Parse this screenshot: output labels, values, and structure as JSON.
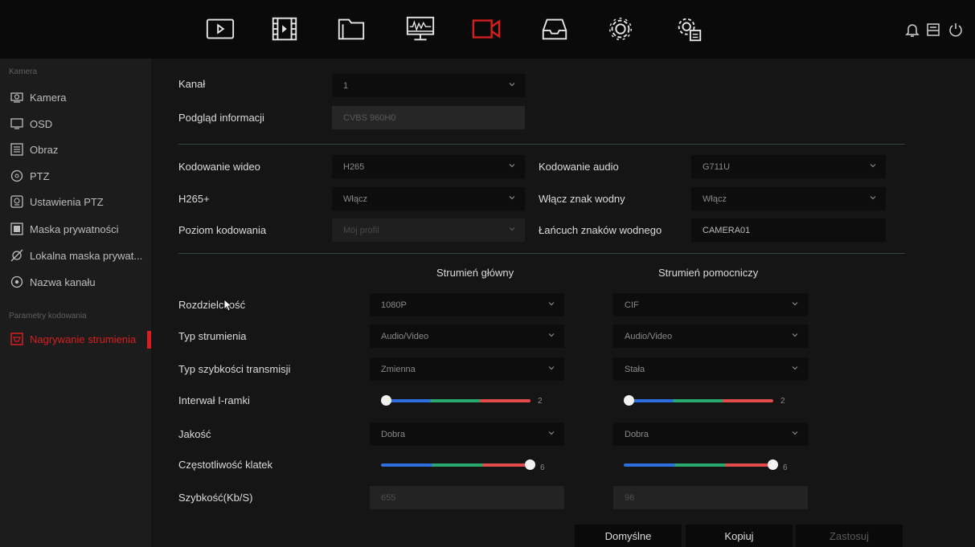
{
  "colors": {
    "accent": "#d81f1f",
    "slider_blue": "#2f6ee0",
    "slider_green": "#28a86c",
    "slider_red": "#e34a4a"
  },
  "topbar": {
    "icons": [
      "playback-icon",
      "video-clip-icon",
      "folder-icon",
      "monitor-icon",
      "camera-icon",
      "storage-icon",
      "gear-icon",
      "system-settings-icon"
    ],
    "active_icon": "camera-icon",
    "system_icons": [
      "bell-icon",
      "printer-icon",
      "power-icon"
    ]
  },
  "sidebar": {
    "section1": "Kamera",
    "items": [
      {
        "label": "Kamera",
        "icon": "camera-small-icon"
      },
      {
        "label": "OSD",
        "icon": "osd-icon"
      },
      {
        "label": "Obraz",
        "icon": "image-icon"
      },
      {
        "label": "PTZ",
        "icon": "ptz-icon"
      },
      {
        "label": "Ustawienia PTZ",
        "icon": "ptz-settings-icon"
      },
      {
        "label": "Maska prywatności",
        "icon": "privacy-mask-icon"
      },
      {
        "label": "Lokalna maska prywat...",
        "icon": "local-mask-icon"
      },
      {
        "label": "Nazwa kanału",
        "icon": "channel-name-icon"
      }
    ],
    "section2": "Parametry kodowania",
    "active_item": {
      "label": "Nagrywanie strumienia",
      "icon": "stream-record-icon"
    }
  },
  "form": {
    "channel_label": "Kanał",
    "channel_value": "1",
    "preview_label": "Podgląd informacji",
    "preview_value": "CVBS 960H0",
    "video_enc_label": "Kodowanie wideo",
    "video_enc_value": "H265",
    "audio_enc_label": "Kodowanie audio",
    "audio_enc_value": "G711U",
    "h265plus_label": "H265+",
    "h265plus_value": "Włącz",
    "watermark_label": "Włącz znak wodny",
    "watermark_value": "Włącz",
    "enc_level_label": "Poziom kodowania",
    "enc_level_value": "Mój profil",
    "watermark_string_label": "Łańcuch znaków wodnego",
    "watermark_string_value": "CAMERA01"
  },
  "streams": {
    "main_header": "Strumień główny",
    "sub_header": "Strumień pomocniczy",
    "resolution_label": "Rozdzielczość",
    "resolution_main": "1080P",
    "resolution_sub": "CIF",
    "stream_type_label": "Typ strumienia",
    "stream_type_main": "Audio/Video",
    "stream_type_sub": "Audio/Video",
    "bitrate_type_label": "Typ szybkości transmisji",
    "bitrate_type_main": "Zmienna",
    "bitrate_type_sub": "Stała",
    "iframe_label": "Interwał I-ramki",
    "iframe_main": "2",
    "iframe_sub": "2",
    "iframe_main_level": 0,
    "iframe_sub_level": 0,
    "quality_label": "Jakość",
    "quality_main": "Dobra",
    "quality_sub": "Dobra",
    "framerate_label": "Częstotliwość klatek",
    "framerate_main": "6",
    "framerate_sub": "6",
    "framerate_main_level": 1,
    "framerate_sub_level": 1,
    "bitrate_label": "Szybkość(Kb/S)",
    "bitrate_main": "655",
    "bitrate_sub": "96"
  },
  "buttons": {
    "default": "Domyślne",
    "copy": "Kopiuj",
    "apply": "Zastosuj"
  }
}
